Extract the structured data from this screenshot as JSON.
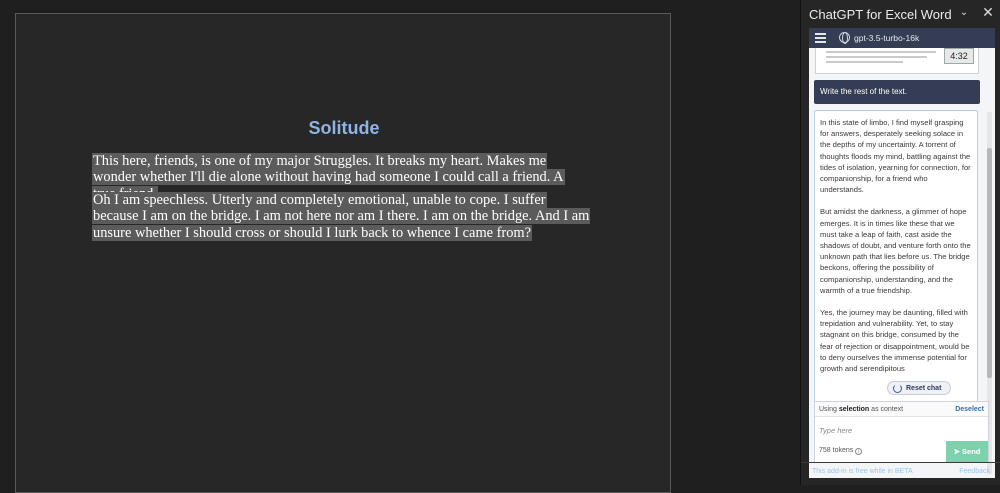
{
  "document": {
    "title": "Solitude",
    "paragraphs": [
      "This here, friends, is one of my major Struggles. It breaks my heart. Makes me wonder whether I'll die alone without having had someone I could call a friend. A true friend.",
      "Oh I am speechless. Utterly and completely emotional, unable to cope. I suffer because I am on the bridge. I am not here nor am I there. I am on the bridge. And I am unsure whether I should cross or should I lurk back to whence I came from?"
    ]
  },
  "pane": {
    "title": "ChatGPT for Excel Word",
    "collapse_icon": "chevron-down-icon",
    "close_icon": "close-icon"
  },
  "app": {
    "model": "gpt-3.5-turbo-16k",
    "video_time": "4:32",
    "user_message": "Write the rest of the text.",
    "reply_paragraphs": [
      "In this state of limbo, I find myself grasping for answers, desperately seeking solace in the depths of my uncertainty. A torrent of thoughts floods my mind, battling against the tides of isolation, yearning for connection, for companionship, for a friend who understands.",
      "But amidst the darkness, a glimmer of hope emerges. It is in times like these that we must take a leap of faith, cast aside the shadows of doubt, and venture forth onto the unknown path that lies before us. The bridge beckons, offering the possibility of companionship, understanding, and the warmth of a true friendship.",
      "Yes, the journey may be daunting, filled with trepidation and vulnerability. Yet, to stay stagnant on this bridge, consumed by the fear of rejection or disappointment, would be to deny ourselves the immense potential for growth and serendipitous"
    ],
    "reset_label": "Reset chat",
    "context_prefix": "Using",
    "context_bold": "selection",
    "context_suffix": "as context",
    "deselect_label": "Deselect",
    "input_placeholder": "Type here",
    "tokens": "758 tokens",
    "send_label": "Send"
  },
  "footer": {
    "beta_text": "This add-in is free while in BETA",
    "feedback_label": "Feedback"
  },
  "colors": {
    "accent_dark": "#353d54",
    "send_green": "#7fd1ae",
    "title_blue": "#8fb4e3"
  }
}
